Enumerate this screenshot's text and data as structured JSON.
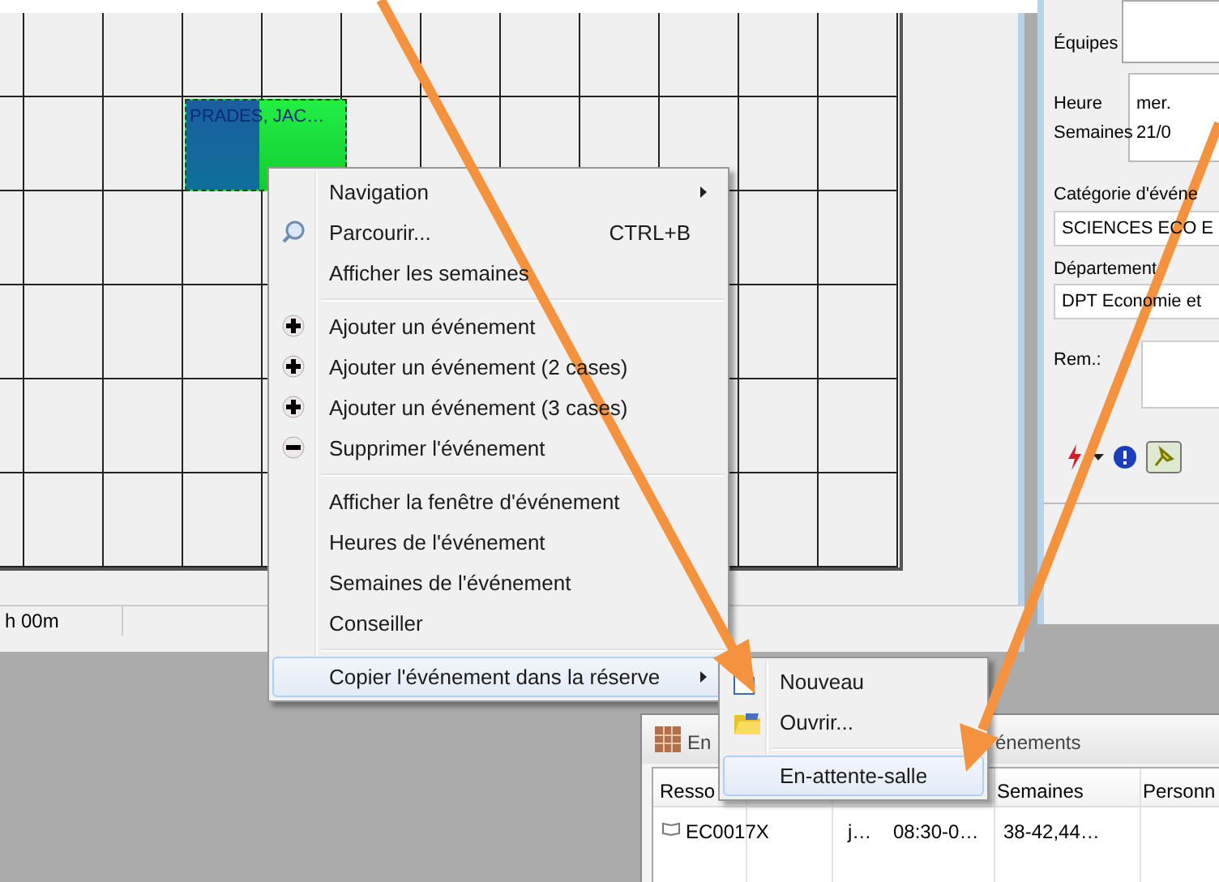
{
  "schedule": {
    "event": {
      "label": "PRADES, JAC…"
    },
    "status_text": "h 00m"
  },
  "details_panel": {
    "team_label": "Équipes",
    "time_labels": [
      "Heure",
      "Semaines"
    ],
    "time_values": [
      "mer.",
      "21/0"
    ],
    "category_label": "Catégorie d'événe",
    "category_value": "SCIENCES ECO E",
    "department_label": "Département",
    "department_value": "DPT Economie et",
    "remarks_label": "Rem.:"
  },
  "context_menu": {
    "items": [
      {
        "kind": "submenu",
        "label": "Navigation",
        "selected": false
      },
      {
        "kind": "search",
        "label": "Parcourir...",
        "shortcut": "CTRL+B",
        "selected": false
      },
      {
        "kind": "plain",
        "label": "Afficher les semaines",
        "selected": false
      },
      {
        "kind": "separator"
      },
      {
        "kind": "add",
        "label": "Ajouter un événement",
        "selected": false
      },
      {
        "kind": "add",
        "label": "Ajouter un événement (2 cases)",
        "selected": false
      },
      {
        "kind": "add",
        "label": "Ajouter un événement (3 cases)",
        "selected": false
      },
      {
        "kind": "remove",
        "label": "Supprimer l'événement",
        "selected": false
      },
      {
        "kind": "separator"
      },
      {
        "kind": "plain",
        "label": "Afficher la fenêtre d'événement",
        "selected": false
      },
      {
        "kind": "plain",
        "label": "Heures de l'événement",
        "selected": false
      },
      {
        "kind": "plain",
        "label": "Semaines de l'événement",
        "selected": false
      },
      {
        "kind": "plain",
        "label": "Conseiller",
        "selected": false
      },
      {
        "kind": "separator"
      },
      {
        "kind": "submenu",
        "label": "Copier l'événement dans la réserve",
        "selected": true
      }
    ]
  },
  "submenu": {
    "items": [
      {
        "kind": "new",
        "label": "Nouveau",
        "selected": false
      },
      {
        "kind": "open",
        "label": "Ouvrir...",
        "selected": false
      },
      {
        "kind": "separator"
      },
      {
        "kind": "plain",
        "label": "En-attente-salle",
        "selected": true
      }
    ]
  },
  "waiting_panel": {
    "title_start": "En",
    "title_end": "énements",
    "columns": [
      "Resso",
      "",
      "",
      "Semaines",
      "Personn"
    ],
    "rows": [
      {
        "cells": [
          "EC0017X",
          "j…",
          "08:30-0…",
          "38-42,44…"
        ]
      }
    ]
  }
}
